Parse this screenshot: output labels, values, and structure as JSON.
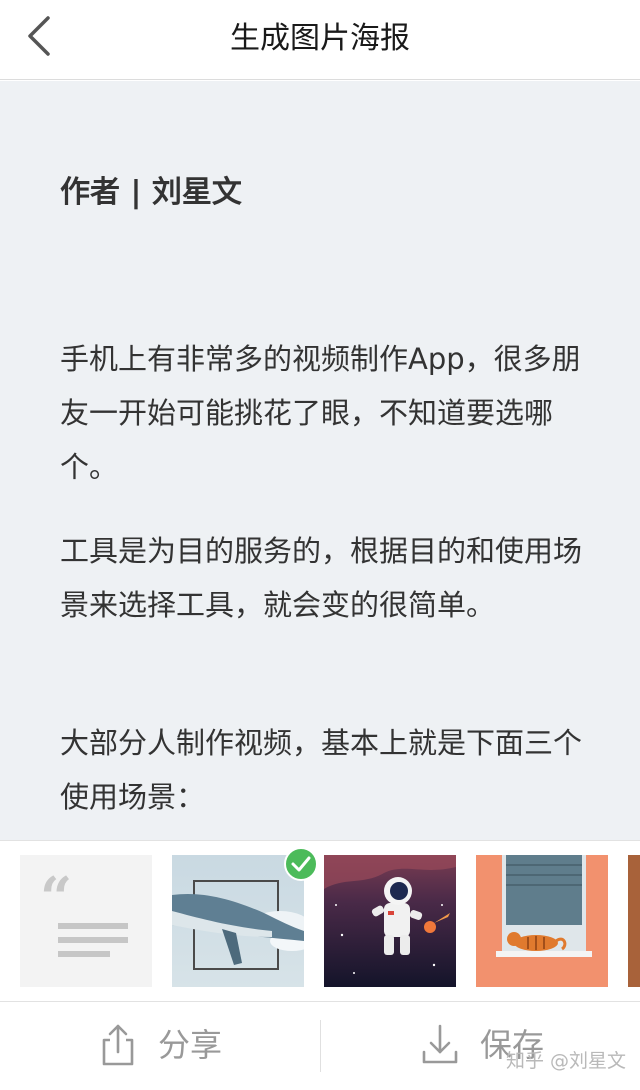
{
  "nav": {
    "title": "生成图片海报",
    "back_icon": "chevron-left-icon"
  },
  "article": {
    "author": "作者 | 刘星文",
    "paragraphs": [
      "手机上有非常多的视频制作App，很多朋友一开始可能挑花了眼，不知道要选哪个。",
      "工具是为目的服务的，根据目的和使用场景来选择工具，就会变的很简单。",
      "大部分人制作视频，基本上就是下面三个使用场景："
    ]
  },
  "themes": {
    "selected_index": 1,
    "items": [
      {
        "name": "quote-theme"
      },
      {
        "name": "whale-theme"
      },
      {
        "name": "astronaut-theme"
      },
      {
        "name": "cat-window-theme"
      },
      {
        "name": "partial-theme"
      }
    ],
    "check_color": "#4cbb5a"
  },
  "actions": {
    "share_label": "分享",
    "save_label": "保存"
  },
  "watermark": "知乎 @刘星文",
  "colors": {
    "content_bg": "#eef1f4",
    "text": "#333333",
    "muted": "#999999"
  }
}
